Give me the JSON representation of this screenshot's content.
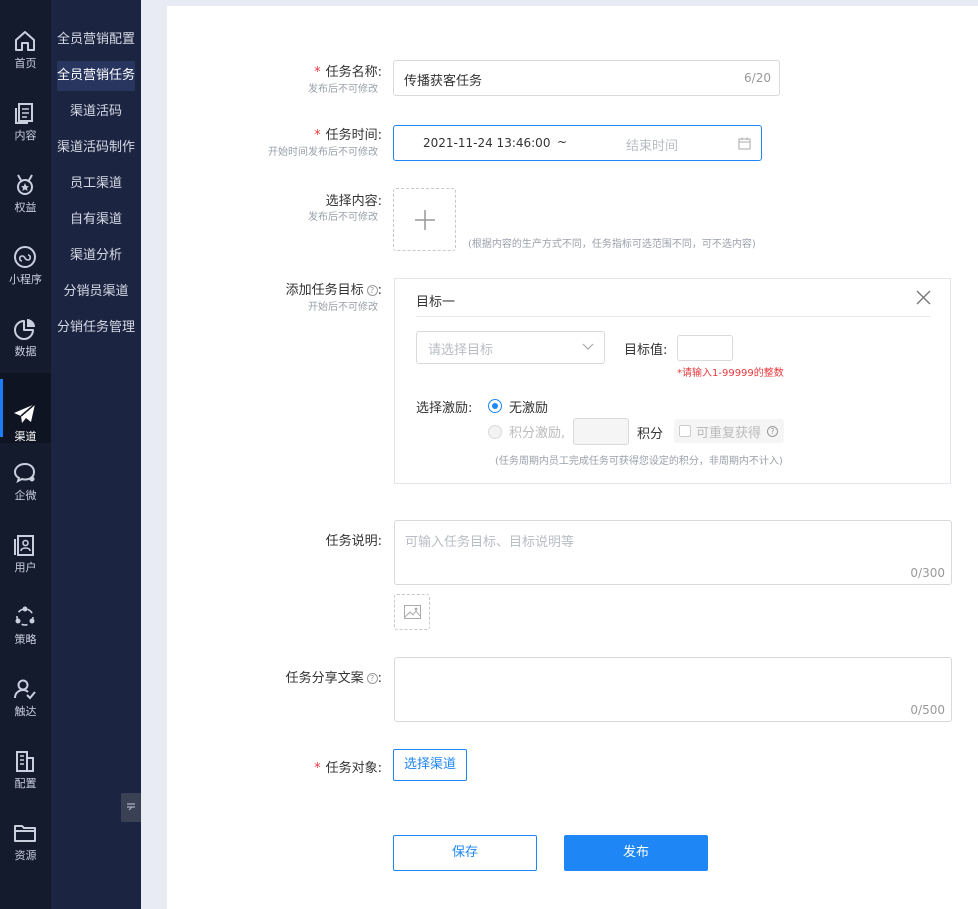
{
  "rail": [
    {
      "icon": "home-icon",
      "label": "首页"
    },
    {
      "icon": "content-icon",
      "label": "内容"
    },
    {
      "icon": "medal-icon",
      "label": "权益"
    },
    {
      "icon": "miniprogram-icon",
      "label": "小程序"
    },
    {
      "icon": "pie-chart-icon",
      "label": "数据"
    },
    {
      "icon": "paper-plane-icon",
      "label": "渠道",
      "active": true
    },
    {
      "icon": "wechat-work-icon",
      "label": "企微"
    },
    {
      "icon": "user-card-icon",
      "label": "用户"
    },
    {
      "icon": "strategy-icon",
      "label": "策略"
    },
    {
      "icon": "reach-icon",
      "label": "触达"
    },
    {
      "icon": "building-icon",
      "label": "配置"
    },
    {
      "icon": "folder-icon",
      "label": "资源"
    }
  ],
  "submenu": [
    {
      "label": "全员营销配置"
    },
    {
      "label": "全员营销任务",
      "active": true
    },
    {
      "label": "渠道活码"
    },
    {
      "label": "渠道活码制作"
    },
    {
      "label": "员工渠道"
    },
    {
      "label": "自有渠道"
    },
    {
      "label": "渠道分析"
    },
    {
      "label": "分销员渠道"
    },
    {
      "label": "分销任务管理"
    }
  ],
  "form": {
    "name": {
      "label": "任务名称:",
      "hint": "发布后不可修改",
      "value": "传播获客任务",
      "count": "6/20"
    },
    "time": {
      "label": "任务时间:",
      "hint": "开始时间发布后不可修改",
      "start": "2021-11-24 13:46:00",
      "separator": "~",
      "end_placeholder": "结束时间"
    },
    "content": {
      "label": "选择内容:",
      "hint": "发布后不可修改",
      "note": "(根据内容的生产方式不同，任务指标可选范围不同，可不选内容)"
    },
    "goal": {
      "label": "添加任务目标",
      "colon": ":",
      "hint": "开始后不可修改",
      "card_title": "目标一",
      "select_placeholder": "请选择目标",
      "target_label": "目标值:",
      "target_error": "*请输入1-99999的整数",
      "incentive_label": "选择激励:",
      "option_none": "无激励",
      "option_points": "积分激励,",
      "points_unit": "积分",
      "repeat_label": "可重复获得",
      "note": "(任务周期内员工完成任务可获得您设定的积分，非周期内不计入)"
    },
    "desc": {
      "label": "任务说明:",
      "placeholder": "可输入任务目标、目标说明等",
      "count": "0/300"
    },
    "share": {
      "label": "任务分享文案",
      "colon": ":",
      "count": "0/500"
    },
    "target": {
      "label": "任务对象:",
      "button": "选择渠道"
    },
    "save": "保存",
    "publish": "发布"
  },
  "colors": {
    "primary": "#1f86f5",
    "required": "#e6393d",
    "rail_bg": "#141b2d",
    "submenu_bg": "#1b2440"
  }
}
